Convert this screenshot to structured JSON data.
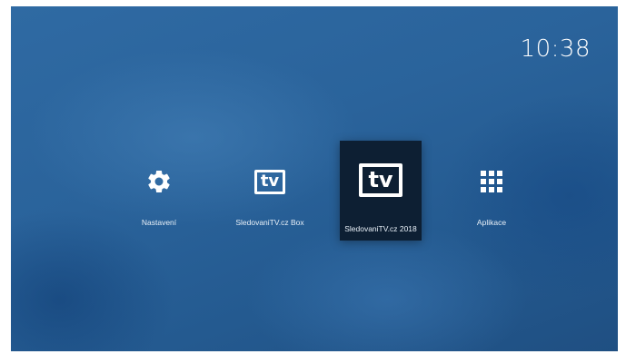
{
  "status": {
    "time": "10:38"
  },
  "apps": [
    {
      "label": "Nastavení",
      "icon": "gear-icon"
    },
    {
      "label": "SledovaniTV.cz Box",
      "icon": "tv-logo-icon",
      "icon_text": "tv"
    },
    {
      "label": "SledovaniTV.cz 2018",
      "icon": "tv-logo-icon",
      "icon_text": "tv",
      "selected": true
    },
    {
      "label": "Aplikace",
      "icon": "app-grid-icon"
    }
  ],
  "colors": {
    "background": "#2a639b",
    "selected_tile": "#0d1f33",
    "text": "#ffffff"
  }
}
